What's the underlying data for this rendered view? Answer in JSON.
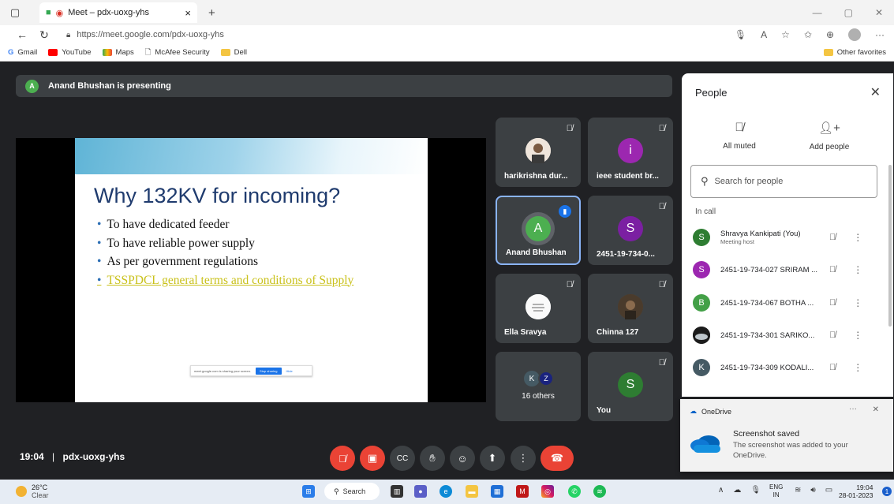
{
  "browser": {
    "tab_title": "Meet – pdx-uoxg-yhs",
    "tab_close": "×",
    "new_tab": "+",
    "url": "https://meet.google.com/pdx-uoxg-yhs",
    "favorites": [
      "Gmail",
      "YouTube",
      "Maps",
      "McAfee Security",
      "Dell"
    ],
    "other_favorites": "Other favorites"
  },
  "meet": {
    "presenting_initial": "A",
    "presenting_text": "Anand Bhushan is presenting",
    "slide": {
      "title": "Why 132KV for incoming?",
      "bullets": [
        "To have dedicated feeder",
        "To have reliable power supply",
        "As per government regulations",
        "TSSPDCL general terms and conditions of Supply"
      ],
      "share_text": "meet.google.com is sharing your screen.",
      "share_stop": "Stop sharing",
      "share_hide": "Hide"
    },
    "tiles": [
      {
        "name": "harikrishna dur...",
        "initial": "",
        "color": "#e0e0e0"
      },
      {
        "name": "ieee student br...",
        "initial": "i",
        "color": "#9c27b0"
      },
      {
        "name": "Anand Bhushan",
        "initial": "A",
        "color": "#4caf50"
      },
      {
        "name": "2451-19-734-0...",
        "initial": "S",
        "color": "#7b1fa2"
      },
      {
        "name": "Ella Sravya",
        "initial": "",
        "color": "#f5f5f5"
      },
      {
        "name": "Chinna 127",
        "initial": "",
        "color": "#5d4a37"
      },
      {
        "name": "16 others",
        "initial": "K",
        "color": "#455a64"
      },
      {
        "name": "You",
        "initial": "S",
        "color": "#2e7d32"
      }
    ],
    "meeting_time": "19:04",
    "meeting_code": "pdx-uoxg-yhs"
  },
  "people": {
    "title": "People",
    "all_muted": "All muted",
    "add_people": "Add people",
    "search_placeholder": "Search for people",
    "in_call": "In call",
    "participants": [
      {
        "initial": "S",
        "color": "#2e7d32",
        "name": "Shravya Kankipati (You)",
        "sub": "Meeting host"
      },
      {
        "initial": "S",
        "color": "#9c27b0",
        "name": "2451-19-734-027 SRIRAM ...",
        "sub": ""
      },
      {
        "initial": "B",
        "color": "#43a047",
        "name": "2451-19-734-067 BOTHA ...",
        "sub": ""
      },
      {
        "initial": "",
        "color": "#222222",
        "name": "2451-19-734-301 SARIKO...",
        "sub": ""
      },
      {
        "initial": "K",
        "color": "#455a64",
        "name": "2451-19-734-309 KODALI...",
        "sub": ""
      }
    ]
  },
  "onedrive": {
    "app": "OneDrive",
    "title": "Screenshot saved",
    "text": "The screenshot was added to your OneDrive."
  },
  "taskbar": {
    "temp": "26°C",
    "weather": "Clear",
    "search": "Search",
    "lang": "ENG",
    "region": "IN",
    "time": "19:04",
    "date": "28-01-2023",
    "badge": "1"
  }
}
